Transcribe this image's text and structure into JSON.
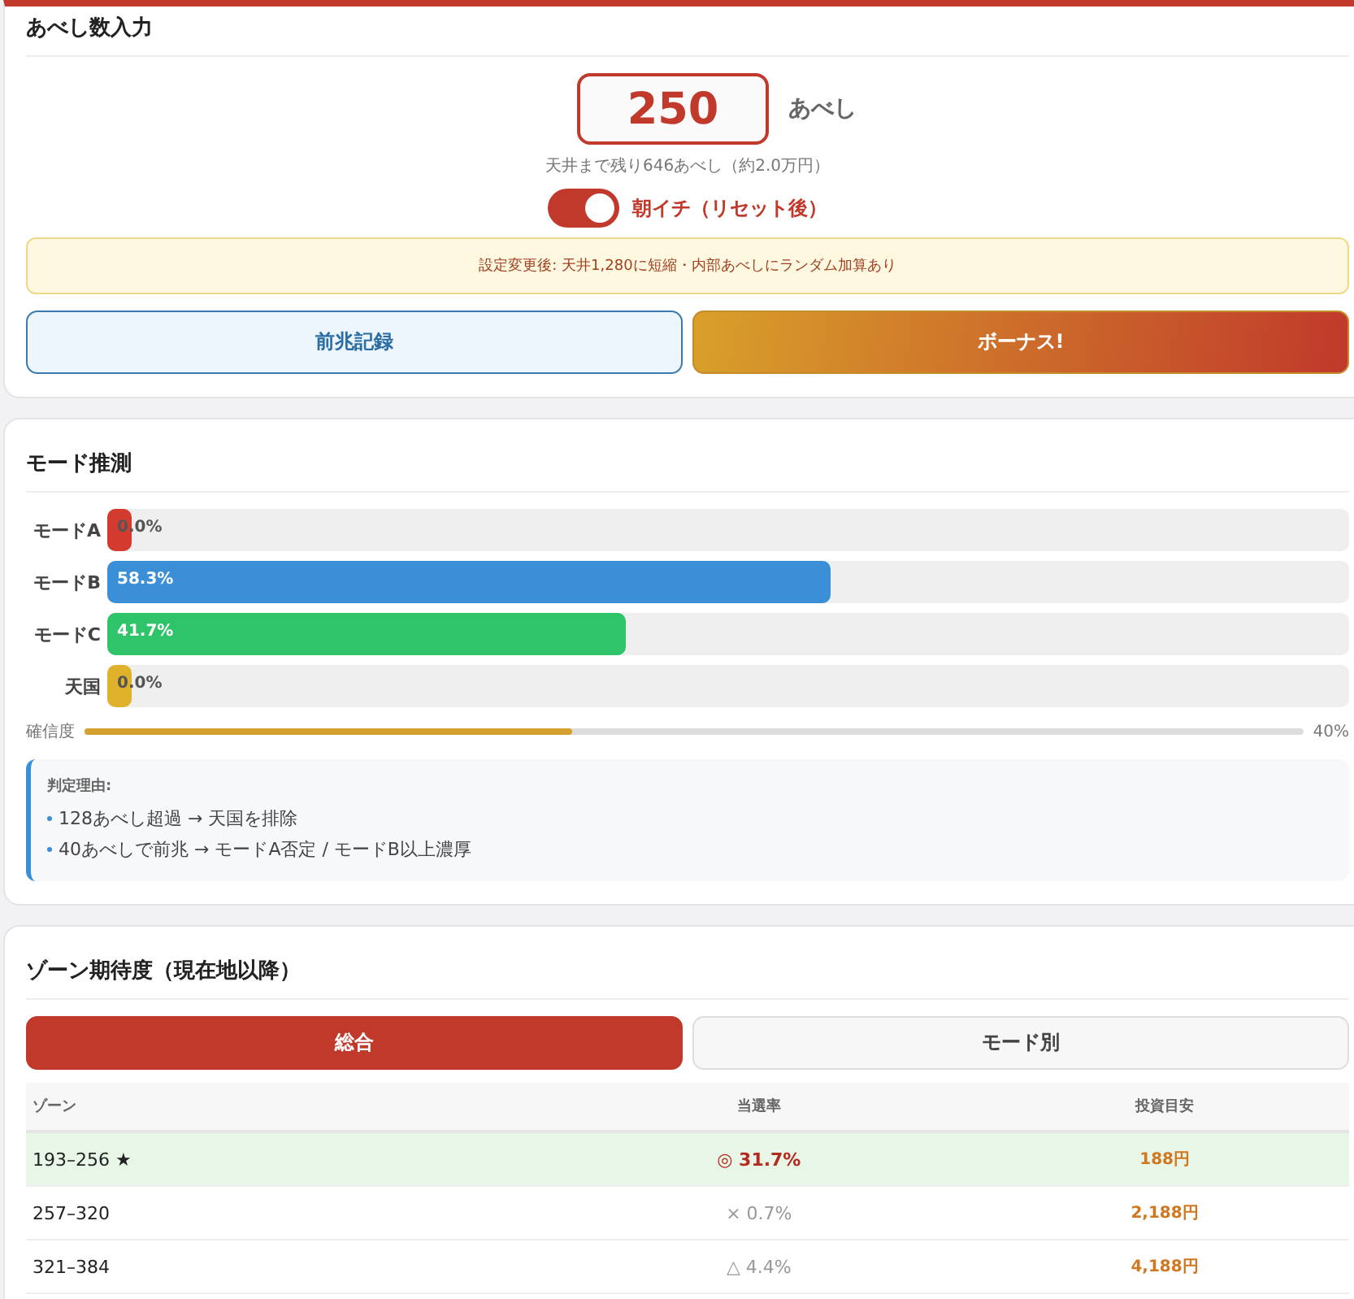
{
  "input_card": {
    "title": "あべし数入力",
    "value": "250",
    "unit": "あべし",
    "remaining": "天井まで残り646あべし（約2.0万円）",
    "toggle": {
      "label": "朝イチ（リセット後）",
      "on": true
    },
    "notice": "設定変更後: 天井1,280に短縮・内部あべしにランダム加算あり",
    "buttons": [
      {
        "label": "前兆記録",
        "kind": "secondary"
      },
      {
        "label": "ボーナス!",
        "kind": "primary"
      }
    ]
  },
  "mode_card": {
    "title": "モード推測",
    "modes": [
      {
        "name": "モードA",
        "reading": "0.0%",
        "level": 0,
        "color": "#d23b2e"
      },
      {
        "name": "モードB",
        "reading": "58.3%",
        "level": 0.583,
        "color": "#3a8fd6"
      },
      {
        "name": "モードC",
        "reading": "41.7%",
        "level": 0.417,
        "color": "#2fc36a"
      },
      {
        "name": "天国",
        "reading": "0.0%",
        "level": 0,
        "color": "#e0b12a"
      }
    ],
    "confidence": {
      "label": "確信度",
      "level": 0.4,
      "reading": "40%"
    },
    "reasons": {
      "title": "判定理由:",
      "items": [
        "128あべし超過 → 天国を排除",
        "40あべしで前兆 → モードA否定 / モードB以上濃厚"
      ]
    }
  },
  "zone_card": {
    "title": "ゾーン期待度（現在地以降）",
    "tabs": [
      {
        "label": "総合",
        "selected": true
      },
      {
        "label": "モード別",
        "selected": false
      }
    ],
    "table": {
      "columns": [
        "ゾーン",
        "当選率",
        "投資目安"
      ],
      "rows": [
        {
          "zone": "193–256 ★",
          "rate": "◎ 31.7%",
          "cost": "188円",
          "highlighted": true
        },
        {
          "zone": "257–320",
          "rate": "× 0.7%",
          "cost": "2,188円",
          "highlighted": false
        },
        {
          "zone": "321–384",
          "rate": "△ 4.4%",
          "cost": "4,188円",
          "highlighted": false
        }
      ]
    }
  }
}
